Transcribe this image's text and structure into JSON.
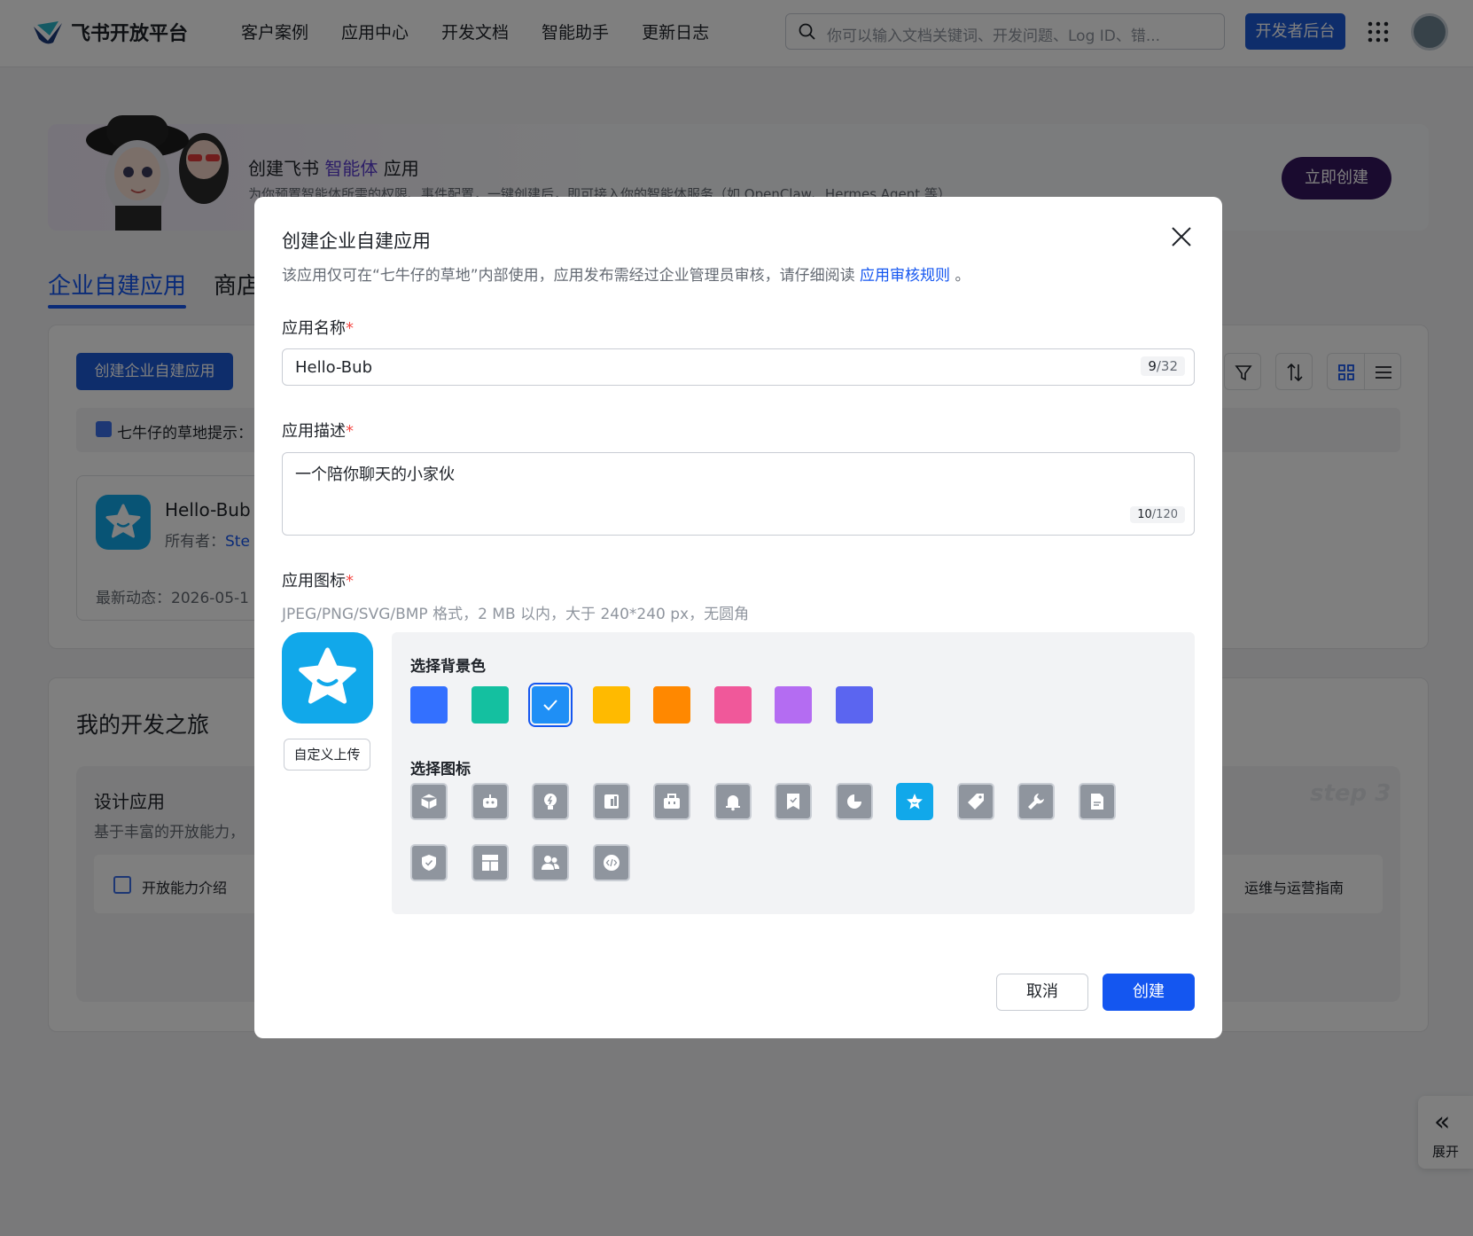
{
  "header": {
    "logo_text": "飞书开放平台",
    "nav": [
      "客户案例",
      "应用中心",
      "开发文档",
      "智能助手",
      "更新日志"
    ],
    "search_placeholder": "你可以输入文档关键词、开发问题、Log ID、错...",
    "dev_console_label": "开发者后台"
  },
  "banner": {
    "title_prefix": "创建飞书 ",
    "title_highlight": "智能体",
    "title_suffix": " 应用",
    "subtitle": "为你预置智能体所需的权限、事件配置，一键创建后，即可接入你的智能体服务（如 OpenClaw、Hermes Agent 等）",
    "create_now_label": "立即创建"
  },
  "tabs": [
    "企业自建应用",
    "商店"
  ],
  "main": {
    "create_enterprise_app_label": "创建企业自建应用",
    "tip_text": "七牛仔的草地提示：",
    "app_card": {
      "name": "Hello-Bub",
      "owner_label": "所有者：",
      "owner_value": "Ste",
      "recent_label": "最新动态：2026-05-1"
    }
  },
  "journey": {
    "title": "我的开发之旅",
    "design_title": "设计应用",
    "design_sub": "基于丰富的开放能力，",
    "feature_1": "开放能力介绍",
    "feature_2": "运维与运营指南",
    "step_label": "step 3"
  },
  "expand_label": "展开",
  "modal": {
    "title": "创建企业自建应用",
    "desc_prefix": "该应用仅可在“七牛仔的草地”内部使用，应用发布需经过企业管理员审核，请仔细阅读",
    "desc_link": "应用审核规则",
    "desc_suffix": "。",
    "name_label": "应用名称",
    "name_value": "Hello-Bub",
    "name_count": "9",
    "name_max": "/32",
    "desc_label": "应用描述",
    "desc_value": "一个陪你聊天的小家伙",
    "desc_count": "10",
    "desc_max": "/120",
    "icon_label": "应用图标",
    "icon_hint": "JPEG/PNG/SVG/BMP 格式，2 MB 以内，大于 240*240 px，无圆角",
    "upload_label": "自定义上传",
    "bg_color_label": "选择背景色",
    "bg_colors": [
      "#3370ff",
      "#14c0a0",
      "#1f8ff5",
      "#ffba00",
      "#ff8800",
      "#f0589a",
      "#b46cf2",
      "#5b65f0"
    ],
    "selected_color_index": 2,
    "icon_choose_label": "选择图标",
    "icons": [
      "cube-icon",
      "robot-icon",
      "bulb-icon",
      "book-icon",
      "briefcase-icon",
      "bell-icon",
      "bookmark-icon",
      "pie-icon",
      "star-icon",
      "tag-icon",
      "wrench-icon",
      "document-icon",
      "shield-icon",
      "layout-icon",
      "people-icon",
      "code-icon"
    ],
    "selected_icon_index": 8,
    "cancel_label": "取消",
    "create_label": "创建"
  }
}
